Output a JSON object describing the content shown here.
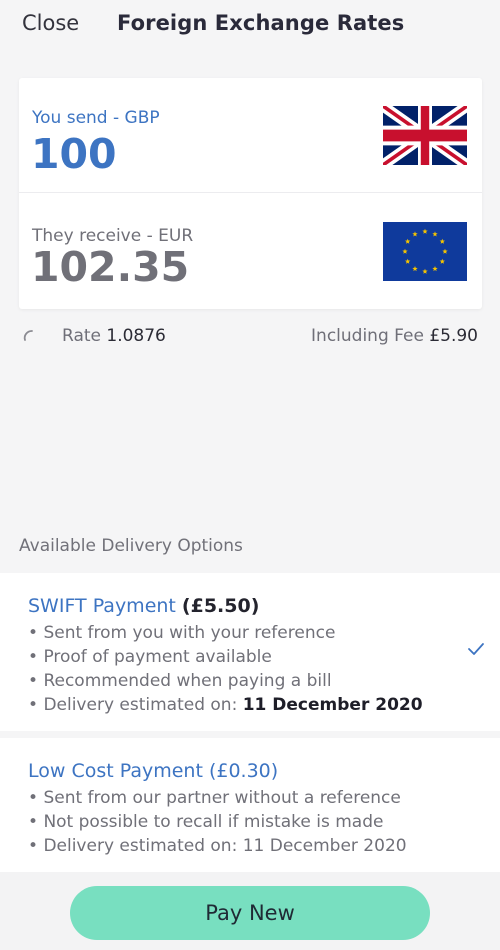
{
  "header": {
    "close_label": "Close",
    "title": "Foreign Exchange Rates"
  },
  "converter": {
    "send": {
      "label": "You send - GBP",
      "amount": "100",
      "flag": "uk-flag-icon"
    },
    "receive": {
      "label": "They receive - EUR",
      "amount": "102.35",
      "flag": "eu-flag-icon"
    }
  },
  "rate_info": {
    "rate_label": "Rate",
    "rate_value": "1.0876",
    "fee_label": "Including Fee",
    "fee_value": "£5.90",
    "spinner_icon": "loading-spinner-icon"
  },
  "delivery": {
    "section_title": "Available Delivery Options",
    "options": [
      {
        "name": "SWIFT Payment",
        "price": "(£5.50)",
        "selected": true,
        "bullets": [
          "Sent from you with your reference",
          "Proof of payment available",
          "Recommended when paying a bill"
        ],
        "delivery_prefix": "Delivery estimated on:",
        "delivery_date": "11 December 2020",
        "check_icon": "checkmark-icon"
      },
      {
        "name": "Low Cost Payment (£0.30)",
        "selected": false,
        "bullets": [
          "Sent from our partner without a reference",
          "Not possible to recall if mistake is made",
          "Delivery estimated on: 11 December 2020"
        ]
      }
    ]
  },
  "footer": {
    "pay_label": "Pay New"
  },
  "colors": {
    "accent_blue": "#3d74c2",
    "button_green": "#78dfc0",
    "background": "#f5f5f6"
  }
}
